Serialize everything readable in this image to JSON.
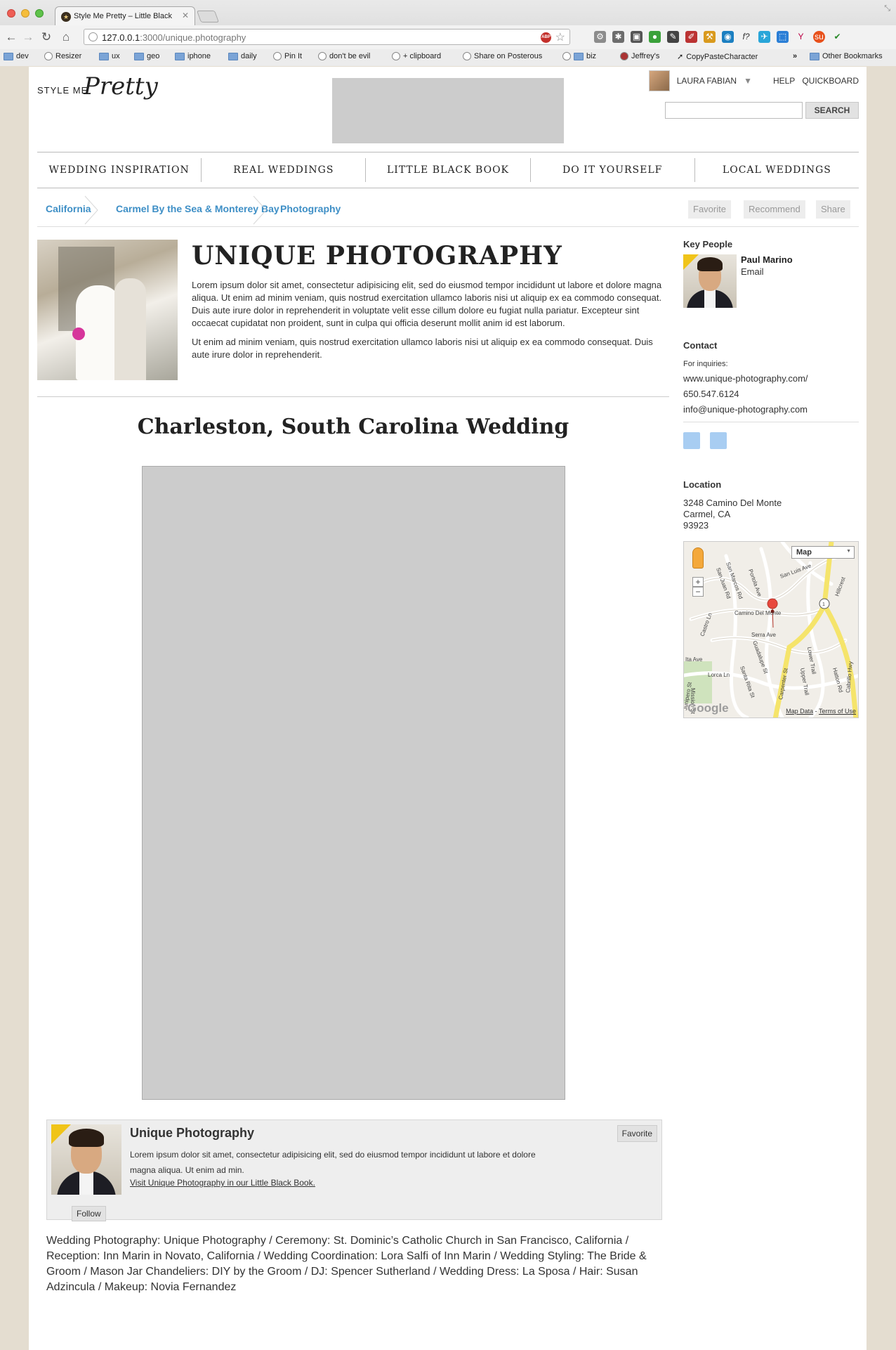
{
  "browser": {
    "tab_title": "Style Me Pretty – Little Black",
    "url_host": "127.0.0.1",
    "url_rest": ":3000/unique.photography",
    "bookmarks": [
      "dev",
      "Resizer",
      "ux",
      "geo",
      "iphone",
      "daily",
      "Pin It",
      "don't be evil",
      "+ clipboard",
      "Share on Posterous",
      "biz",
      "Jeffrey's",
      "CopyPasteCharacter"
    ],
    "bookmarks_more": "»",
    "other_bookmarks": "Other Bookmarks"
  },
  "site": {
    "logo_part1": "STYLE ME",
    "logo_part2": "Pretty",
    "user_name": "LAURA FABIAN",
    "help": "HELP",
    "quickboard": "QUICKBOARD",
    "search_button": "SEARCH",
    "search_placeholder": ""
  },
  "nav": [
    "WEDDING INSPIRATION",
    "REAL WEDDINGS",
    "LITTLE BLACK BOOK",
    "DO IT YOURSELF",
    "LOCAL WEDDINGS"
  ],
  "breadcrumb": [
    "California",
    "Carmel By the Sea & Monterey Bay",
    "Photography"
  ],
  "actions": [
    "Favorite",
    "Recommend",
    "Share"
  ],
  "vendor": {
    "title": "UNIQUE PHOTOGRAPHY",
    "p1": "Lorem ipsum dolor sit amet, consectetur adipisicing elit, sed do eiusmod tempor incididunt ut labore et dolore magna aliqua. Ut enim ad minim veniam, quis nostrud exercitation ullamco laboris nisi ut aliquip ex ea commodo consequat. Duis aute irure dolor in reprehenderit in voluptate velit esse cillum dolore eu fugiat nulla pariatur. Excepteur sint occaecat cupidatat non proident, sunt in culpa qui officia deserunt mollit anim id est laborum.",
    "p2": "Ut enim ad minim veniam, quis nostrud exercitation ullamco laboris nisi ut aliquip ex ea commodo consequat. Duis aute irure dolor in reprehenderit."
  },
  "post": {
    "title": "Charleston, South Carolina Wedding"
  },
  "vendor_box": {
    "name": "Unique Photography",
    "favorite": "Favorite",
    "follow": "Follow",
    "text": "Lorem ipsum dolor sit amet, consectetur adipisicing elit, sed do eiusmod tempor incididunt ut labore et dolore magna aliqua. Ut enim ad min.",
    "link": "Visit Unique Photography in our Little Black Book."
  },
  "credits": "Wedding Photography: Unique Photography / Ceremony: St. Dominic’s Catholic Church in San Francisco, California / Reception: Inn Marin in Novato, California / Wedding Coordination: Lora Salfi of Inn Marin / Wedding Styling: The Bride & Groom / Mason Jar Chandeliers: DIY by the Groom / DJ: Spencer Sutherland / Wedding Dress: La Sposa / Hair: Susan Adzincula / Makeup: Novia Fernandez",
  "sidebar": {
    "key_people_heading": "Key People",
    "person_name": "Paul Marino",
    "person_email": "Email",
    "contact_heading": "Contact",
    "inquiries_label": "For inquiries:",
    "website": "www.unique-photography.com/",
    "phone": "650.547.6124",
    "email": "info@unique-photography.com",
    "location_heading": "Location",
    "address_line1": "3248 Camino Del Monte",
    "address_line2": "Carmel, CA",
    "address_line3": "93923",
    "map_type": "Map",
    "map_streets": [
      "Camino Del Monte",
      "Serra Ave",
      "Lorca Ln",
      "Carpenter St",
      "San Marcos Rd",
      "Portola Ave",
      "San Luis Ave",
      "Santa Rita St",
      "Guadalupe St",
      "Upper Trail",
      "Hatton Rd",
      "Castro Ln",
      "Ita Ave",
      "Mission St",
      "Cabrillo Hwy",
      "San Juan Rd",
      "Lower Trail",
      "Hillcrest",
      "Junipero St"
    ],
    "map_route": "1",
    "map_google": "Google",
    "map_data": "Map Data",
    "map_terms": "Terms of Use"
  }
}
